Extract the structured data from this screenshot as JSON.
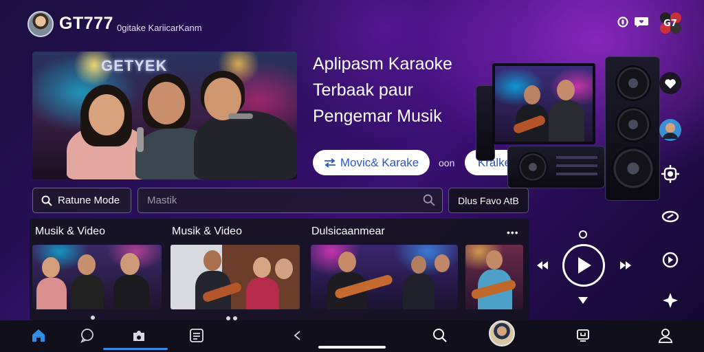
{
  "header": {
    "brand": "GT777",
    "subtitle": "0gitake KariicarKanm",
    "icons": [
      "profile-avatar",
      "notification-icon",
      "heart-chat-icon",
      "app-badge-icon"
    ]
  },
  "hero": {
    "sign_text": "GETYEK",
    "title_lines": [
      "Aplipasm Karaoke",
      "Terbaak paur",
      "Pengemar Musik"
    ],
    "primary_button": "Movic&  Karake",
    "or_text": "oon",
    "secondary_button": "Kralke"
  },
  "search": {
    "mode_label": "Ratune Mode",
    "placeholder": "Mastik",
    "right_button": "Dlus Favo AtB"
  },
  "sections": {
    "titles": [
      "Musik & Video",
      "Musik & Video",
      "Dulsicaanmear"
    ],
    "more": "•••"
  },
  "colors": {
    "accent": "#2f8de8",
    "button_text": "#2a55c7",
    "panel": "#16141f",
    "background": "#2a0f5c"
  },
  "nav": {
    "items": [
      "home-icon",
      "chat-icon",
      "puzzle-icon",
      "playlist-icon",
      "back-icon",
      "search-icon",
      "avatar",
      "tv-icon",
      "profile-icon"
    ],
    "active": "home-icon"
  }
}
